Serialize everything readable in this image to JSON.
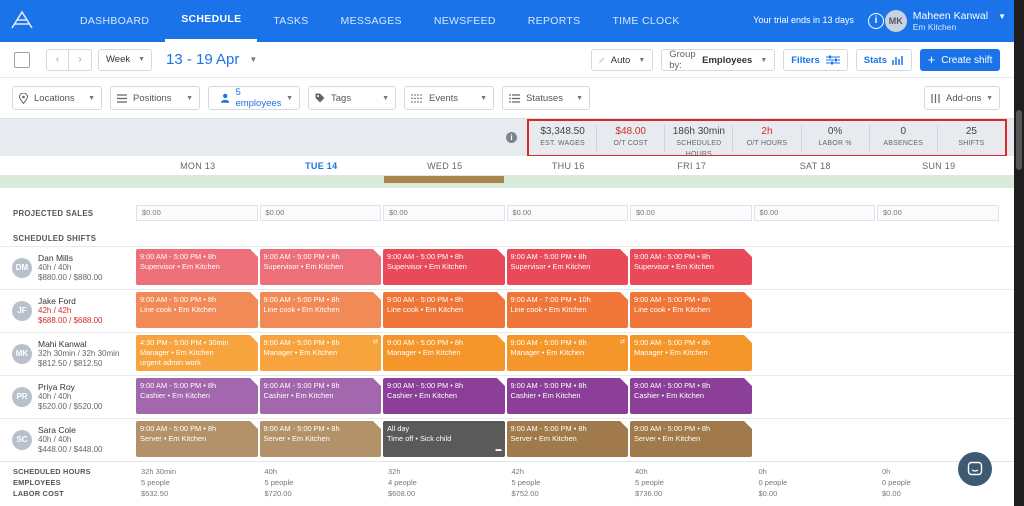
{
  "nav": {
    "items": [
      {
        "label": "DASHBOARD"
      },
      {
        "label": "SCHEDULE"
      },
      {
        "label": "TASKS"
      },
      {
        "label": "MESSAGES"
      },
      {
        "label": "NEWSFEED"
      },
      {
        "label": "REPORTS"
      },
      {
        "label": "TIME CLOCK"
      }
    ],
    "trial_text": "Your trial ends in 13 days",
    "user_initials": "MK",
    "user_name": "Maheen Kanwal",
    "user_location": "Em Kitchen"
  },
  "toolbar": {
    "view": "Week",
    "date_range": "13 - 19 Apr",
    "auto": "Auto",
    "group_by_label": "Group by:",
    "group_by_value": "Employees",
    "filters": "Filters",
    "stats": "Stats",
    "create": "Create shift"
  },
  "filters": {
    "locations": "Locations",
    "positions": "Positions",
    "employees": "5 employees",
    "tags": "Tags",
    "events": "Events",
    "statuses": "Statuses",
    "addons": "Add-ons"
  },
  "summary": {
    "info": "i",
    "stats": [
      {
        "value": "$3,348.50",
        "label": "EST. WAGES",
        "red": false
      },
      {
        "value": "$48.00",
        "label": "O/T COST",
        "red": true
      },
      {
        "value": "186h 30min",
        "label": "SCHEDULED HOURS",
        "red": false
      },
      {
        "value": "2h",
        "label": "O/T HOURS",
        "red": true
      },
      {
        "value": "0%",
        "label": "LABOR %",
        "red": false
      },
      {
        "value": "0",
        "label": "ABSENCES",
        "red": false
      },
      {
        "value": "25",
        "label": "SHIFTS",
        "red": false
      }
    ]
  },
  "days": [
    "MON 13",
    "TUE 14",
    "WED 15",
    "THU 16",
    "FRI 17",
    "SAT 18",
    "SUN 19"
  ],
  "projected_sales_label": "PROJECTED SALES",
  "projected_sales": [
    "$0.00",
    "$0.00",
    "$0.00",
    "$0.00",
    "$0.00",
    "$0.00",
    "$0.00"
  ],
  "scheduled_shifts_label": "SCHEDULED SHIFTS",
  "employees": [
    {
      "initials": "DM",
      "name": "Dan Mills",
      "hours": "40h / 40h",
      "money": "$880.00 / $880.00",
      "over": false,
      "color": "#ec6f7a",
      "shifts": [
        {
          "line1": "9:00 AM - 5:00 PM • 8h",
          "line2": "Supervisor • Em Kitchen",
          "tone": "#ec6f7a"
        },
        {
          "line1": "9:00 AM - 5:00 PM • 8h",
          "line2": "Supervisor • Em Kitchen",
          "tone": "#ec6f7a"
        },
        {
          "line1": "9:00 AM - 5:00 PM • 8h",
          "line2": "Supervisor • Em Kitchen",
          "tone": "#e84a5a"
        },
        {
          "line1": "9:00 AM - 5:00 PM • 8h",
          "line2": "Supervisor • Em Kitchen",
          "tone": "#e84a5a"
        },
        {
          "line1": "9:00 AM - 5:00 PM • 8h",
          "line2": "Supervisor • Em Kitchen",
          "tone": "#e84a5a"
        },
        null,
        null
      ]
    },
    {
      "initials": "JF",
      "name": "Jake Ford",
      "hours": "42h / 42h",
      "money": "$688.00 / $688.00",
      "over": true,
      "color": "#f28a57",
      "shifts": [
        {
          "line1": "9:00 AM - 5:00 PM • 8h",
          "line2": "Line cook • Em Kitchen",
          "tone": "#f28a57"
        },
        {
          "line1": "9:00 AM - 5:00 PM • 8h",
          "line2": "Line cook • Em Kitchen",
          "tone": "#f28a57"
        },
        {
          "line1": "9:00 AM - 5:00 PM • 8h",
          "line2": "Line cook • Em Kitchen",
          "tone": "#ef7538"
        },
        {
          "line1": "9:00 AM - 7:00 PM • 10h",
          "line2": "Line cook • Em Kitchen",
          "tone": "#ef7538"
        },
        {
          "line1": "9:00 AM - 5:00 PM • 8h",
          "line2": "Line cook • Em Kitchen",
          "tone": "#ef7538"
        },
        null,
        null
      ]
    },
    {
      "initials": "MK",
      "name": "Mahi Kanwal",
      "hours": "32h 30min / 32h 30min",
      "money": "$812.50 / $812.50",
      "over": false,
      "color": "#f7a43e",
      "shifts": [
        {
          "line1": "4:30 PM - 5:00 PM • 30min",
          "line2": "Manager • Em Kitchen",
          "line3": "urgent admin work",
          "tone": "#f7a43e"
        },
        {
          "line1": "9:00 AM - 5:00 PM • 8h",
          "line2": "Manager • Em Kitchen",
          "tone": "#f7a43e"
        },
        {
          "line1": "9:00 AM - 5:00 PM • 8h",
          "line2": "Manager • Em Kitchen",
          "tone": "#f5962a"
        },
        {
          "line1": "9:00 AM - 5:00 PM • 8h",
          "line2": "Manager • Em Kitchen",
          "tone": "#f5962a"
        },
        {
          "line1": "9:00 AM - 5:00 PM • 8h",
          "line2": "Manager • Em Kitchen",
          "tone": "#f5962a"
        },
        null,
        null
      ]
    },
    {
      "initials": "PR",
      "name": "Priya Roy",
      "hours": "40h / 40h",
      "money": "$520.00 / $520.00",
      "over": false,
      "color": "#9b5aa6",
      "shifts": [
        {
          "line1": "9:00 AM - 5:00 PM • 8h",
          "line2": "Cashier • Em Kitchen",
          "tone": "#a267ad"
        },
        {
          "line1": "9:00 AM - 5:00 PM • 8h",
          "line2": "Cashier • Em Kitchen",
          "tone": "#a267ad"
        },
        {
          "line1": "9:00 AM - 5:00 PM • 8h",
          "line2": "Cashier • Em Kitchen",
          "tone": "#8c3f98"
        },
        {
          "line1": "9:00 AM - 5:00 PM • 8h",
          "line2": "Cashier • Em Kitchen",
          "tone": "#8c3f98"
        },
        {
          "line1": "9:00 AM - 5:00 PM • 8h",
          "line2": "Cashier • Em Kitchen",
          "tone": "#8c3f98"
        },
        null,
        null
      ]
    },
    {
      "initials": "SC",
      "name": "Sara Cole",
      "hours": "40h / 40h",
      "money": "$448.00 / $448.00",
      "over": false,
      "color": "#b08c5f",
      "shifts": [
        {
          "line1": "9:00 AM - 5:00 PM • 8h",
          "line2": "Server • Em Kitchen",
          "tone": "#b3926a"
        },
        {
          "line1": "9:00 AM - 5:00 PM • 8h",
          "line2": "Server • Em Kitchen",
          "tone": "#b3926a"
        },
        {
          "line1": "All day",
          "line2": "Time off • Sick child",
          "tone": "#5a5a5a"
        },
        {
          "line1": "9:00 AM - 5:00 PM • 8h",
          "line2": "Server • Em Kitchen",
          "tone": "#a07a4b"
        },
        {
          "line1": "9:00 AM - 5:00 PM • 8h",
          "line2": "Server • Em Kitchen",
          "tone": "#a07a4b"
        },
        null,
        null
      ]
    }
  ],
  "totals": {
    "labels": [
      "SCHEDULED HOURS",
      "EMPLOYEES",
      "LABOR COST"
    ],
    "columns": [
      [
        "32h 30min",
        "5 people",
        "$532.50"
      ],
      [
        "40h",
        "5 people",
        "$720.00"
      ],
      [
        "32h",
        "4 people",
        "$608.00"
      ],
      [
        "42h",
        "5 people",
        "$752.00"
      ],
      [
        "40h",
        "5 people",
        "$736.00"
      ],
      [
        "0h",
        "0 people",
        "$0.00"
      ],
      [
        "0h",
        "0 people",
        "$0.00"
      ]
    ]
  }
}
